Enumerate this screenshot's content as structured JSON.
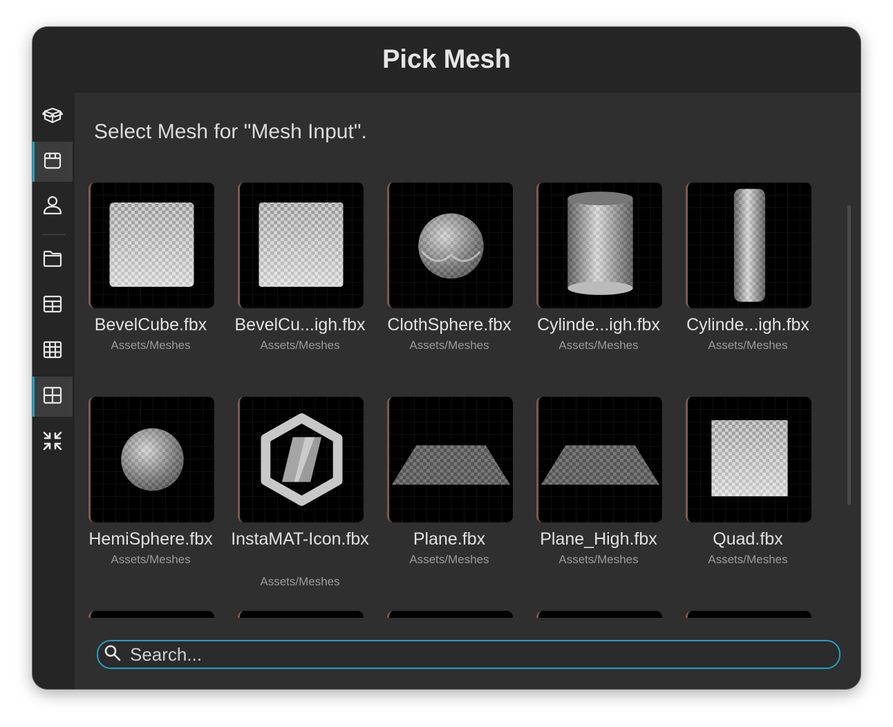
{
  "dialog": {
    "title": "Pick Mesh",
    "subtitle": "Select Mesh for \"Mesh Input\"."
  },
  "sidebar": {
    "items": [
      {
        "icon": "open-box-icon",
        "active": false
      },
      {
        "icon": "box-icon",
        "active": true
      },
      {
        "icon": "user-icon",
        "active": false
      },
      {
        "icon": "folder-icon",
        "active": false
      },
      {
        "icon": "table-icon",
        "active": false
      },
      {
        "icon": "grid-icon",
        "active": false
      },
      {
        "icon": "grid-large-icon",
        "active": true
      },
      {
        "icon": "collapse-icon",
        "active": false
      }
    ]
  },
  "meshes": [
    {
      "name": "BevelCube.fbx",
      "path": "Assets/Meshes",
      "shape": "cube"
    },
    {
      "name": "BevelCu...igh.fbx",
      "path": "Assets/Meshes",
      "shape": "cube"
    },
    {
      "name": "ClothSphere.fbx",
      "path": "Assets/Meshes",
      "shape": "cloth-sphere"
    },
    {
      "name": "Cylinde...igh.fbx",
      "path": "Assets/Meshes",
      "shape": "cylinder"
    },
    {
      "name": "Cylinde...igh.fbx",
      "path": "Assets/Meshes",
      "shape": "thin-cylinder"
    },
    {
      "name": "HemiSphere.fbx",
      "path": "Assets/Meshes",
      "shape": "sphere"
    },
    {
      "name": "InstaMAT-Icon.fbx",
      "path": "Assets/Meshes",
      "shape": "logo"
    },
    {
      "name": "Plane.fbx",
      "path": "Assets/Meshes",
      "shape": "plane"
    },
    {
      "name": "Plane_High.fbx",
      "path": "Assets/Meshes",
      "shape": "plane"
    },
    {
      "name": "Quad.fbx",
      "path": "Assets/Meshes",
      "shape": "quad"
    }
  ],
  "search": {
    "placeholder": "Search...",
    "value": ""
  },
  "colors": {
    "accent": "#1ea3c5",
    "background": "#2f2f2f",
    "header": "#252525"
  }
}
